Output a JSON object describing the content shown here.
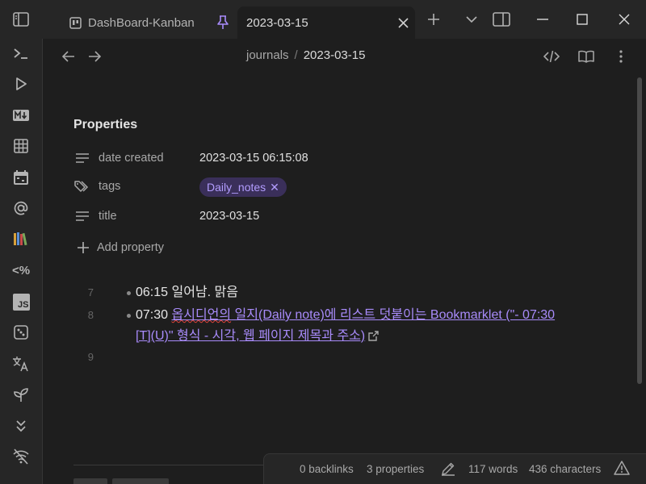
{
  "titlebar": {
    "tabs": [
      {
        "label": "DashBoard-Kanban",
        "icon": "kanban-icon",
        "active": false
      },
      {
        "label": "2023-03-15",
        "icon": "close-icon",
        "active": true
      }
    ],
    "pin_icon": "pin-icon",
    "new_tab_icon": "plus-icon",
    "tab_list_icon": "chevron-down-icon",
    "sidebar_toggle_right_icon": "sidebar-right-icon",
    "sidebar_toggle_left_icon": "sidebar-left-icon",
    "window_controls": [
      "minimize-icon",
      "maximize-icon",
      "close-icon"
    ]
  },
  "ribbon": {
    "items": [
      "terminal-icon",
      "play-icon",
      "markdown-icon",
      "table-icon",
      "calendar-icon",
      "at-icon",
      "books-icon",
      "templater-icon",
      "javascript-icon",
      "dice-icon",
      "translate-icon",
      "sprout-icon",
      "chevrons-down-icon",
      "wifi-off-icon"
    ],
    "templater_label": "<%",
    "js_label": "JS"
  },
  "header": {
    "breadcrumb": {
      "folder": "journals",
      "separator": "/",
      "file": "2023-03-15"
    },
    "actions": [
      "source-mode-icon",
      "reading-view-icon",
      "more-options-icon"
    ]
  },
  "properties": {
    "title": "Properties",
    "rows": [
      {
        "key": "date created",
        "value": "2023-03-15 06:15:08",
        "icon": "text-lines-icon"
      },
      {
        "key": "tags",
        "value": "Daily_notes",
        "icon": "tags-icon"
      },
      {
        "key": "title",
        "value": "2023-03-15",
        "icon": "text-lines-icon"
      }
    ],
    "add_label": "Add property"
  },
  "editor": {
    "lines": [
      {
        "num": "7",
        "time": "06:15",
        "text": " 일어남. 맑음"
      },
      {
        "num": "8",
        "time": "07:30",
        "link_spell": "옵시디언의",
        "link_line1_rest": " 일지(Daily note)에 리스트 덧붙이는 Bookmarklet (\"- 07:30",
        "link_line2": "[T](U)\" 형식 - 시각, 웹 페이지 제목과 주소)"
      },
      {
        "num": "9"
      }
    ]
  },
  "statusbar": {
    "backlinks": "0 backlinks",
    "properties": "3 properties",
    "words": "117 words",
    "characters": "436 characters",
    "edit_icon": "pencil-icon",
    "warning_icon": "warning-icon"
  },
  "colors": {
    "background": "#1e1e1e",
    "chrome": "#262626",
    "accent": "#a88bfa",
    "tag_bg": "#3a2f5a",
    "spellcheck": "#e0443a"
  }
}
